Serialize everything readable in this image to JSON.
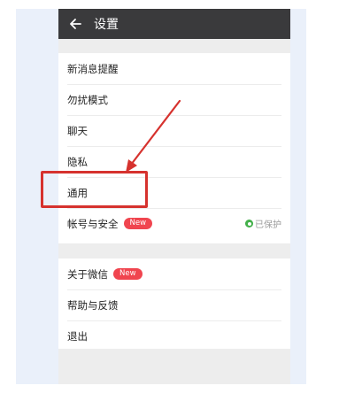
{
  "titlebar": {
    "back_icon": "back-arrow-icon",
    "title": "设置"
  },
  "group1": {
    "items": [
      {
        "label": "新消息提醒"
      },
      {
        "label": "勿扰模式"
      },
      {
        "label": "聊天"
      },
      {
        "label": "隐私"
      },
      {
        "label": "通用"
      },
      {
        "label": "帐号与安全",
        "badge": "New",
        "status": "已保护"
      }
    ]
  },
  "group2": {
    "items": [
      {
        "label": "关于微信",
        "badge": "New"
      },
      {
        "label": "帮助与反馈"
      },
      {
        "label": "退出"
      }
    ]
  },
  "annotation": {
    "highlight_color": "#d6322e",
    "highlighted_item": "通用"
  },
  "colors": {
    "titlebar": "#3a3a3c",
    "badge": "#f0454f",
    "status_ok": "#43b04a",
    "background": "#ededed"
  }
}
